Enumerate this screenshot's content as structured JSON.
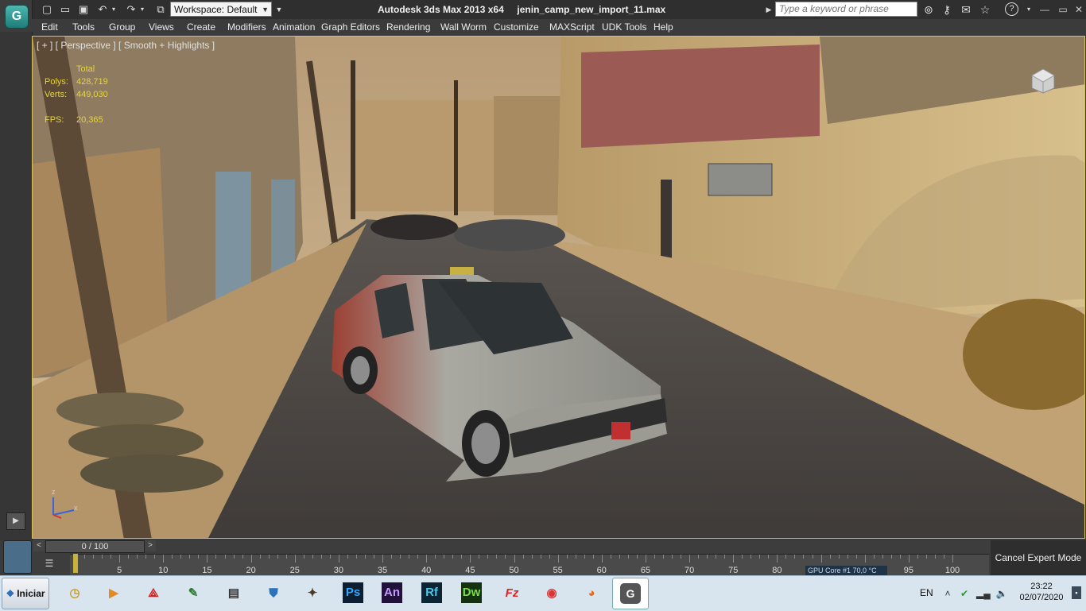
{
  "title_bar": {
    "app_title": "Autodesk 3ds Max  2013 x64",
    "file_name": "jenin_camp_new_import_11.max",
    "workspace_label": "Workspace: Default",
    "search_placeholder": "Type a keyword or phrase"
  },
  "menu": {
    "items": [
      "Edit",
      "Tools",
      "Group",
      "Views",
      "Create",
      "Modifiers",
      "Animation",
      "Graph Editors",
      "Rendering",
      "Wall Worm",
      "Customize",
      "MAXScript",
      "UDK Tools",
      "Help"
    ]
  },
  "viewport": {
    "label": "[ + ] [ Perspective ] [ Smooth + Highlights ]",
    "stats": {
      "total_label": "Total",
      "polys_label": "Polys:",
      "polys_value": "428,719",
      "verts_label": "Verts:",
      "verts_value": "449,030",
      "fps_label": "FPS:",
      "fps_value": "20,365"
    },
    "axis_labels": {
      "z": "z",
      "x": "x"
    }
  },
  "timeline": {
    "slider_text": "0 / 100",
    "ticks": [
      "5",
      "10",
      "15",
      "20",
      "25",
      "30",
      "35",
      "40",
      "45",
      "50",
      "55",
      "60",
      "65",
      "70",
      "75",
      "80",
      "85",
      "90",
      "95",
      "100"
    ],
    "current_frame": 0,
    "frame_count": 100,
    "gpu_core_text": "GPU Core #1  70,0 °C",
    "cancel_expert_label": "Cancel Expert Mode"
  },
  "taskbar": {
    "start_label": "Iniciar",
    "apps": [
      {
        "name": "ps",
        "label": "Ps",
        "bg": "#0d1e33",
        "fg": "#30a8ff"
      },
      {
        "name": "an",
        "label": "An",
        "bg": "#22113a",
        "fg": "#c59bff"
      },
      {
        "name": "rf",
        "label": "Rf",
        "bg": "#0b2534",
        "fg": "#4fc3e6"
      },
      {
        "name": "dw",
        "label": "Dw",
        "bg": "#14320f",
        "fg": "#7cdc4a"
      }
    ],
    "language": "EN",
    "time": "23:22",
    "date": "02/07/2020"
  },
  "colors": {
    "viewport_border": "#d6c25a",
    "stats_text": "#e5d343",
    "ui_dark": "#3b3b3b"
  }
}
